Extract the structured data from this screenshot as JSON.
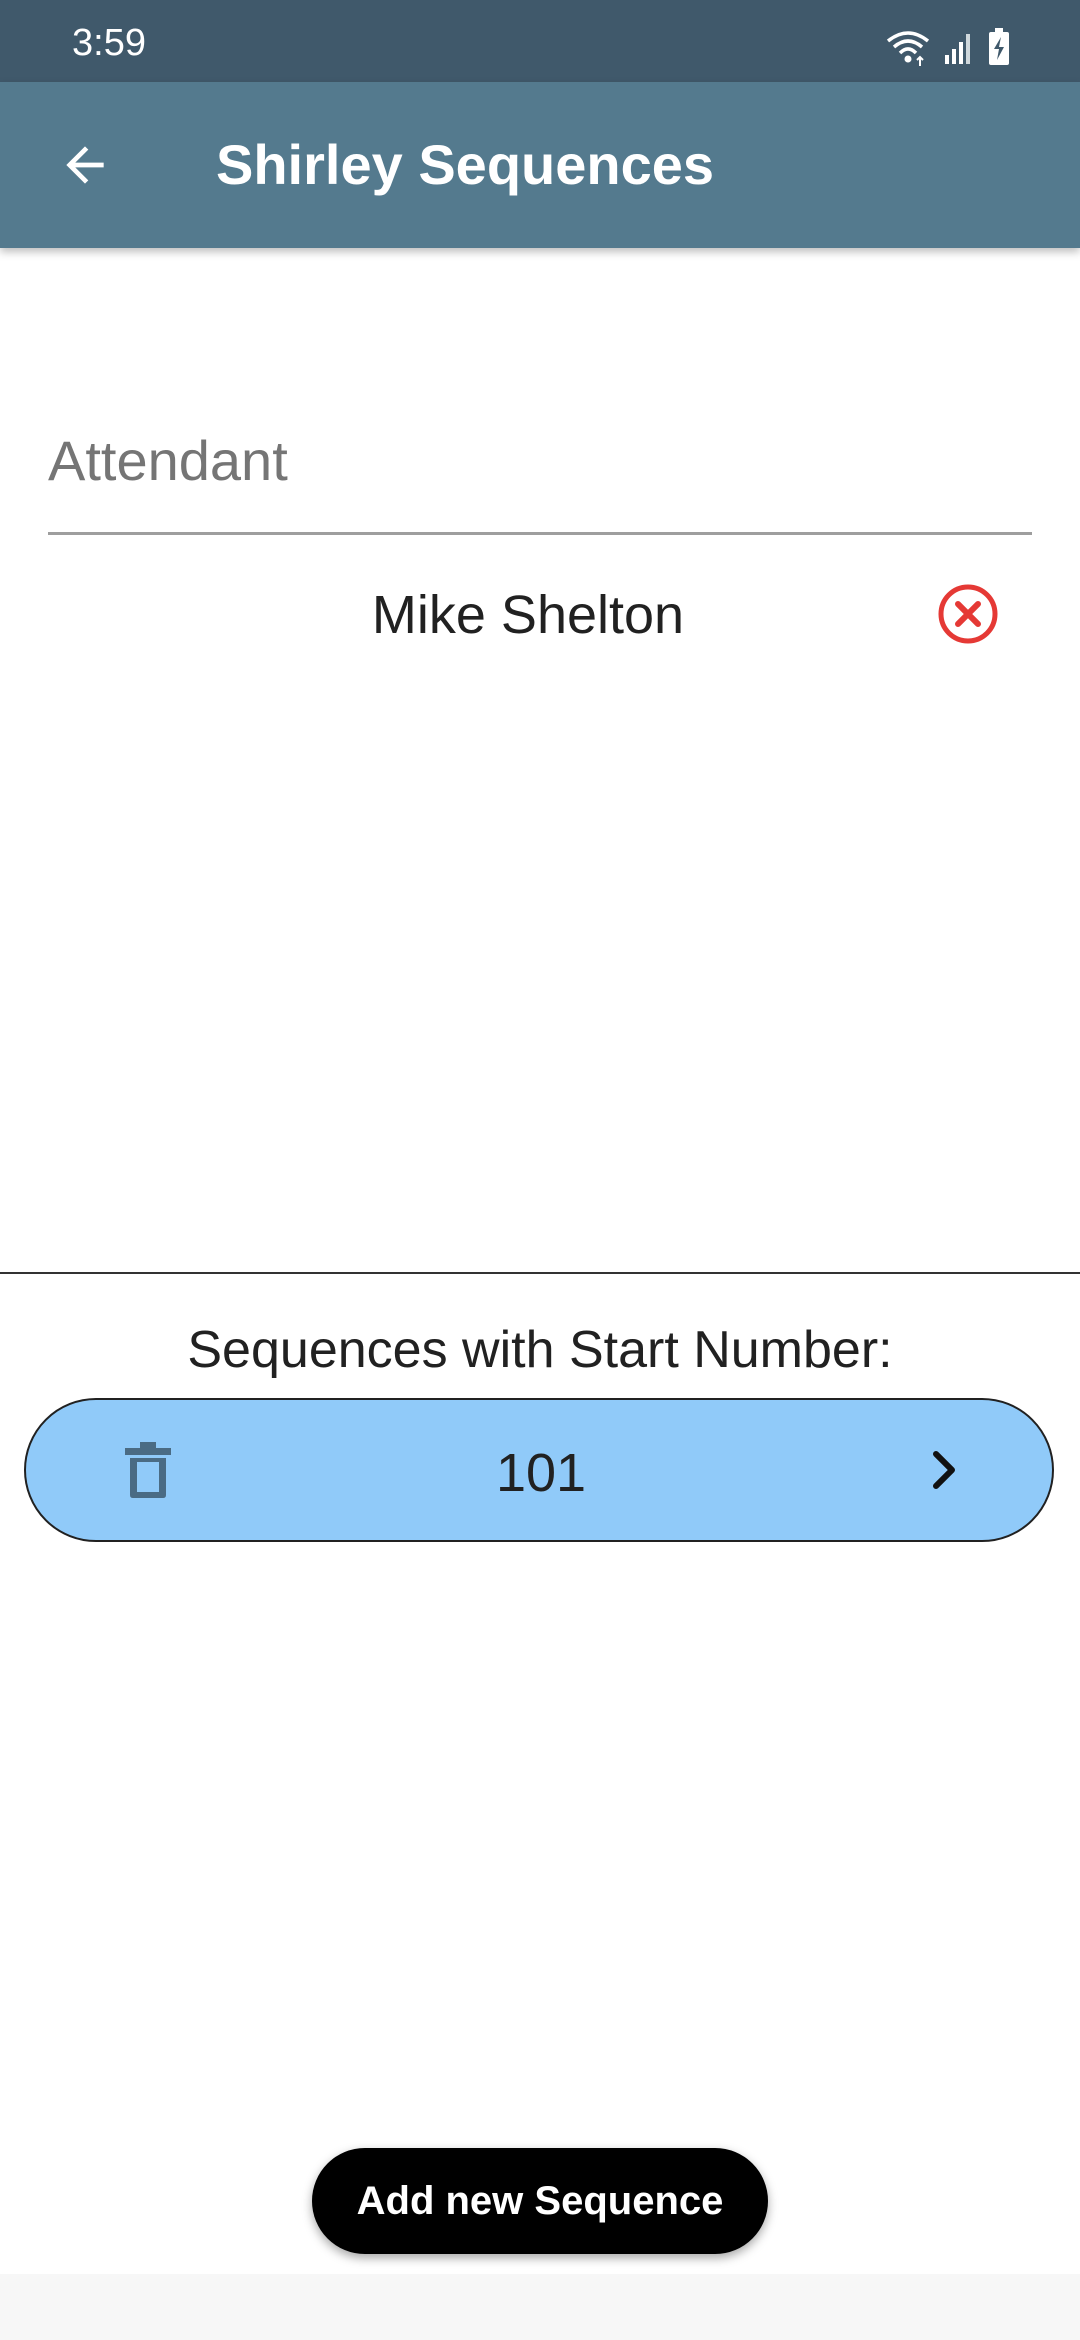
{
  "status_bar": {
    "time": "3:59",
    "icons": [
      "wifi-icon",
      "signal-icon",
      "battery-charging-icon"
    ]
  },
  "app_bar": {
    "back_icon": "arrow-left-icon",
    "title": "Shirley Sequences"
  },
  "attendant": {
    "label": "Attendant",
    "name": "Mike Shelton",
    "remove_icon": "close-circle-icon"
  },
  "sequences": {
    "heading": "Sequences with Start Number:",
    "items": [
      {
        "number": "101",
        "delete_icon": "trash-icon",
        "open_icon": "chevron-right-icon"
      }
    ]
  },
  "actions": {
    "add_label": "Add new Sequence"
  },
  "colors": {
    "status_bar": "#40596b",
    "app_bar": "#547a8e",
    "sequence_item": "#90caf9",
    "remove_icon": "#e53935",
    "add_button": "#000000"
  }
}
